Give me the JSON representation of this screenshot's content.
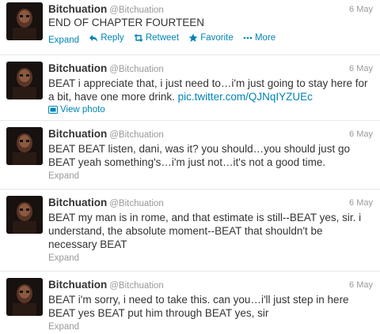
{
  "tweets": [
    {
      "fullname": "Bitchuation",
      "username": "@Bitchuation",
      "time": "6 May",
      "text": "END OF CHAPTER FOURTEEN",
      "actions": {
        "expand": "Expand",
        "reply": "Reply",
        "retweet": "Retweet",
        "favorite": "Favorite",
        "more": "More"
      }
    },
    {
      "fullname": "Bitchuation",
      "username": "@Bitchuation",
      "time": "6 May",
      "text": "BEAT i appreciate that, i just need to…i'm just going to stay here for a bit, have one more drink.",
      "link": "pic.twitter.com/QJNqIYZUEc",
      "view_photo": "View photo"
    },
    {
      "fullname": "Bitchuation",
      "username": "@Bitchuation",
      "time": "6 May",
      "text": "BEAT BEAT listen, dani, was it? you should…you should just go BEAT yeah something's…i'm just not…it's not a good time.",
      "expand": "Expand"
    },
    {
      "fullname": "Bitchuation",
      "username": "@Bitchuation",
      "time": "6 May",
      "text": "BEAT my man is in rome, and that estimate is still--BEAT yes, sir. i understand, the absolute moment--BEAT that shouldn't be necessary BEAT",
      "expand": "Expand"
    },
    {
      "fullname": "Bitchuation",
      "username": "@Bitchuation",
      "time": "6 May",
      "text": "BEAT i'm sorry, i need to take this. can you…i'll just step in here BEAT yes BEAT put him through BEAT yes, sir",
      "expand": "Expand"
    }
  ],
  "icons": {
    "reply": "reply-arrow-icon",
    "retweet": "retweet-icon",
    "favorite": "star-icon",
    "more": "more-dots-icon",
    "photo": "photo-icon"
  },
  "colors": {
    "link": "#0084b4",
    "muted": "#999999",
    "text": "#333333"
  }
}
